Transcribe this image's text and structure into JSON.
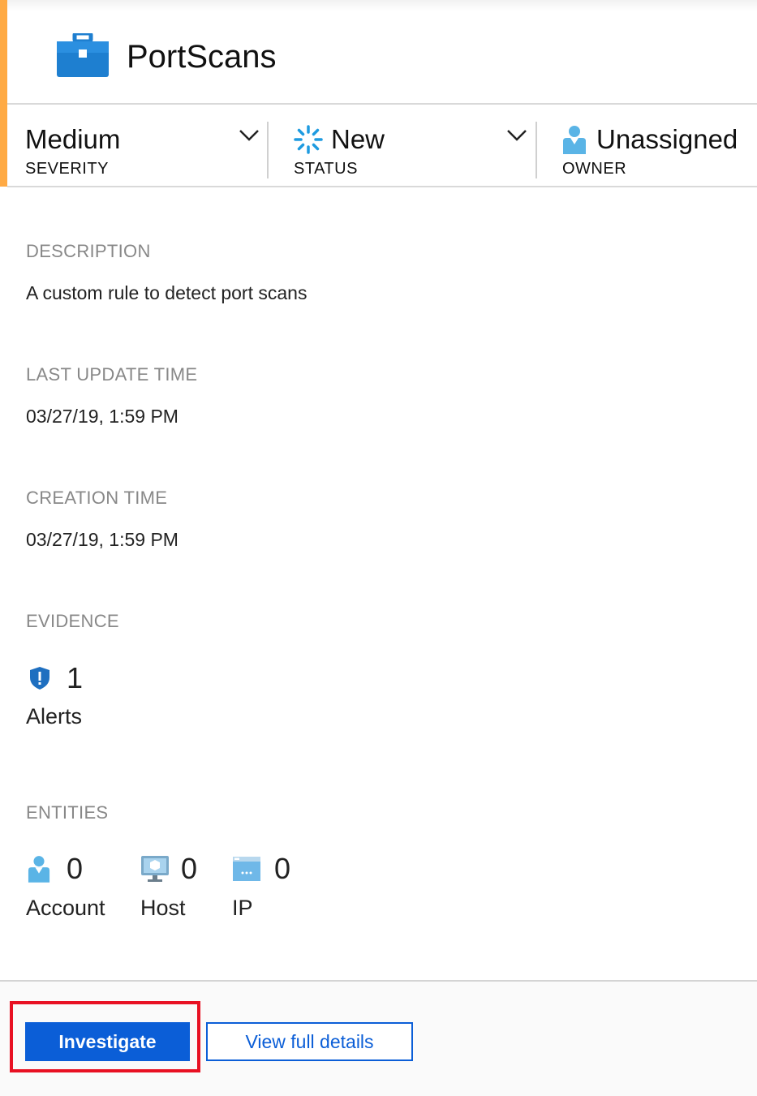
{
  "header": {
    "title": "PortScans",
    "icon": "briefcase-icon",
    "accent_color": "#ffaa44"
  },
  "status_bar": {
    "severity": {
      "value": "Medium",
      "label": "SEVERITY"
    },
    "status": {
      "value": "New",
      "label": "STATUS",
      "icon": "spinner-new-icon"
    },
    "owner": {
      "value": "Unassigned",
      "label": "OWNER",
      "icon": "user-icon"
    }
  },
  "details": {
    "description_label": "DESCRIPTION",
    "description_value": "A custom rule to detect port scans",
    "last_update_label": "LAST UPDATE TIME",
    "last_update_value": "03/27/19, 1:59 PM",
    "creation_label": "CREATION TIME",
    "creation_value": "03/27/19, 1:59 PM"
  },
  "evidence": {
    "label": "EVIDENCE",
    "alerts": {
      "count": "1",
      "label": "Alerts",
      "icon": "shield-alert-icon"
    }
  },
  "entities": {
    "label": "ENTITIES",
    "items": [
      {
        "count": "0",
        "label": "Account",
        "icon": "user-icon"
      },
      {
        "count": "0",
        "label": "Host",
        "icon": "monitor-icon"
      },
      {
        "count": "0",
        "label": "IP",
        "icon": "ip-window-icon"
      }
    ]
  },
  "actions": {
    "investigate_label": "Investigate",
    "view_details_label": "View full details",
    "primary_color": "#0b5ed7",
    "highlight_color": "#e81123"
  }
}
